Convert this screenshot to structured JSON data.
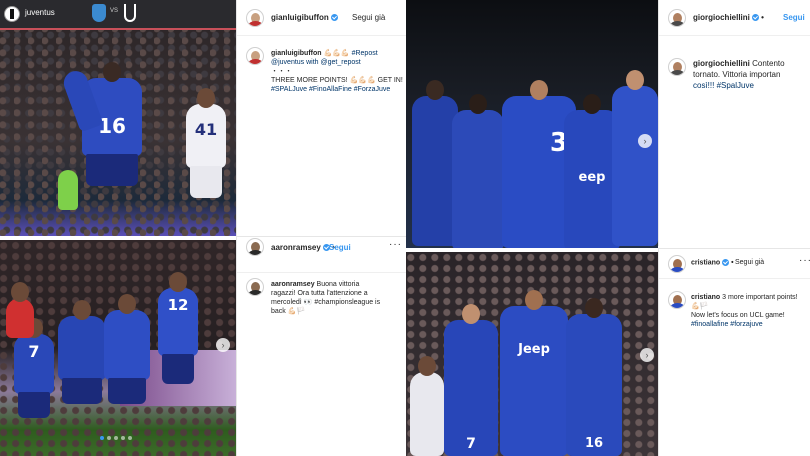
{
  "juventus_header": {
    "username": "juventus",
    "more_icon": "ellipsis-icon"
  },
  "buffon_post": {
    "username": "gianluigibuffon",
    "follow_status": "Segui già",
    "caption_user": "gianluigibuffon",
    "caption_line1": "💪🏻💪🏻💪🏻 #Repost",
    "caption_line2": "@juventus with @get_repost",
    "caption_line3": "・・・",
    "caption_line4": "THREE MORE POINTS! 💪🏻💪🏻💪🏻 GET IN!",
    "caption_line5": "#SPALJuve #FinoAllaFine #ForzaJuve"
  },
  "ramsey_post": {
    "username": "aaronramsey",
    "follow_status": "Segui",
    "caption_user": "aaronramsey",
    "caption_line1": "Buona vittoria",
    "caption_line2": "ragazzi! Ora tutta l'attenzione a",
    "caption_line3": "mercoledì 👀 #championsleague is",
    "caption_line4": "back 💪🏻🏳️"
  },
  "chiellini_post": {
    "username": "giorgiochiellini",
    "follow_status": "Segui",
    "caption_user": "giorgiochiellini",
    "caption_line1": "Contento",
    "caption_line2": "tornato. Vittoria importan",
    "caption_line3": "così!!! #SpalJuve"
  },
  "ronaldo_post": {
    "username": "cristiano",
    "follow_status": "Segui già",
    "caption_user": "cristiano",
    "caption_line1": "3 more important points!",
    "caption_line2": "💪🏻🏳️",
    "caption_line3": "Now let's focus on UCL game!",
    "caption_line4": "#finoallafine #forzajuve"
  },
  "photos": {
    "top_left": {
      "numbers": [
        "16",
        "41"
      ]
    },
    "bottom_left": {
      "numbers": [
        "7",
        "12"
      ]
    },
    "top_center": {
      "numbers": [
        "3"
      ],
      "sponsor": "eep"
    },
    "bottom_center": {
      "numbers": [
        "7",
        "16"
      ],
      "sponsor": "Jeep"
    }
  },
  "colors": {
    "juve_blue": "#2a48b8",
    "juve_dark": "#1b2a7a",
    "ig_blue": "#3897f0",
    "pitch": "#3d6b2a"
  }
}
